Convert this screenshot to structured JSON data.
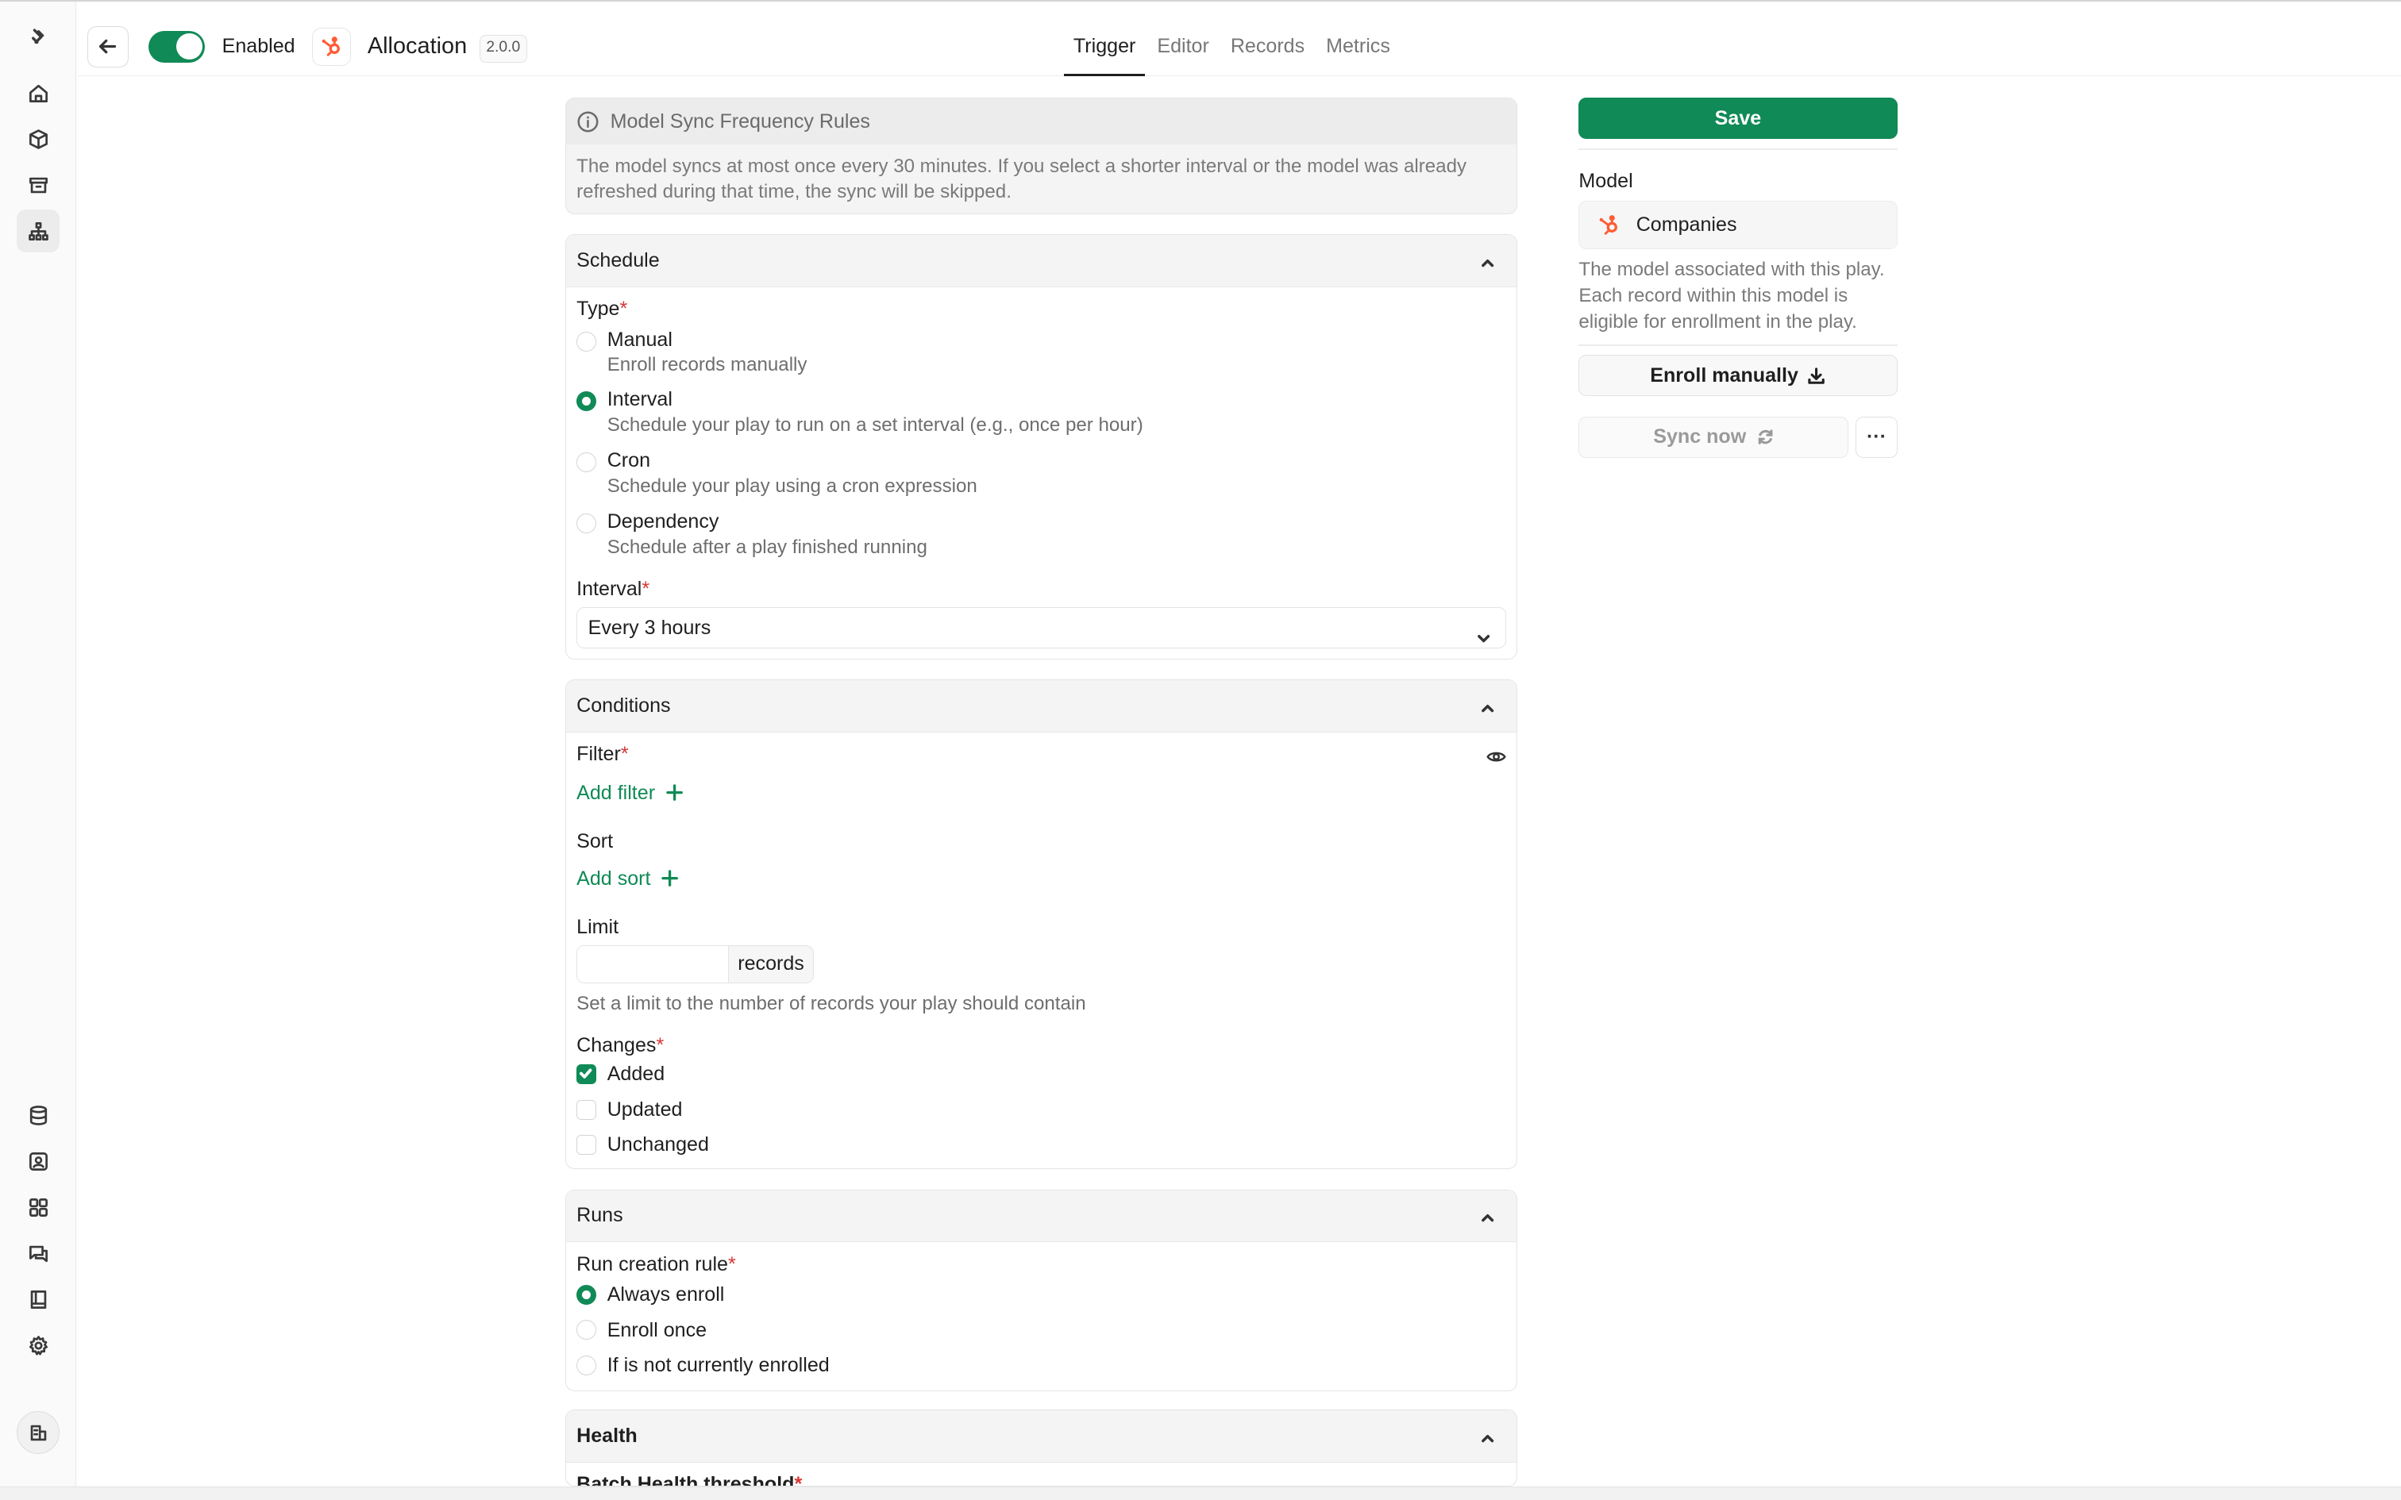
{
  "colors": {
    "accent": "#108a56",
    "required": "#d93636",
    "hubspot": "#ff5c35"
  },
  "header": {
    "enabled_label": "Enabled",
    "play_title": "Allocation",
    "version": "2.0.0",
    "tabs": [
      {
        "label": "Trigger",
        "active": true
      },
      {
        "label": "Editor",
        "active": false
      },
      {
        "label": "Records",
        "active": false
      },
      {
        "label": "Metrics",
        "active": false
      }
    ]
  },
  "info": {
    "title": "Model Sync Frequency Rules",
    "body": "The model syncs at most once every 30 minutes. If you select a shorter interval or the model was already refreshed during that time, the sync will be skipped."
  },
  "schedule": {
    "title": "Schedule",
    "type_label": "Type",
    "required_mark": "*",
    "options": [
      {
        "label": "Manual",
        "desc": "Enroll records manually",
        "checked": false
      },
      {
        "label": "Interval",
        "desc": "Schedule your play to run on a set interval (e.g., once per hour)",
        "checked": true
      },
      {
        "label": "Cron",
        "desc": "Schedule your play using a cron expression",
        "checked": false
      },
      {
        "label": "Dependency",
        "desc": "Schedule after a play finished running",
        "checked": false
      }
    ],
    "interval_label": "Interval",
    "interval_value": "Every 3 hours"
  },
  "conditions": {
    "title": "Conditions",
    "filter_label": "Filter",
    "add_filter": "Add filter",
    "sort_label": "Sort",
    "add_sort": "Add sort",
    "limit_label": "Limit",
    "limit_value": "",
    "limit_suffix": "records",
    "limit_hint": "Set a limit to the number of records your play should contain",
    "changes_label": "Changes",
    "changes": [
      {
        "label": "Added",
        "checked": true
      },
      {
        "label": "Updated",
        "checked": false
      },
      {
        "label": "Unchanged",
        "checked": false
      }
    ]
  },
  "runs": {
    "title": "Runs",
    "rule_label": "Run creation rule",
    "options": [
      {
        "label": "Always enroll",
        "checked": true
      },
      {
        "label": "Enroll once",
        "checked": false
      },
      {
        "label": "If is not currently enrolled",
        "checked": false
      }
    ]
  },
  "health": {
    "title": "Health",
    "threshold_label": "Batch Health threshold"
  },
  "sidebar": {
    "save_label": "Save",
    "model_label": "Model",
    "model_name": "Companies",
    "model_desc": "The model associated with this play. Each record within this model is eligible for enrollment in the play.",
    "enroll_label": "Enroll manually",
    "sync_label": "Sync now",
    "more_label": "···"
  },
  "rail": {
    "top_icons": [
      "logo-icon",
      "home-icon",
      "cube-icon",
      "archive-icon",
      "hierarchy-icon"
    ],
    "bottom_icons": [
      "database-icon",
      "contact-icon",
      "grid-icon",
      "chat-icon",
      "book-icon",
      "settings-icon",
      "workspace-icon"
    ]
  }
}
